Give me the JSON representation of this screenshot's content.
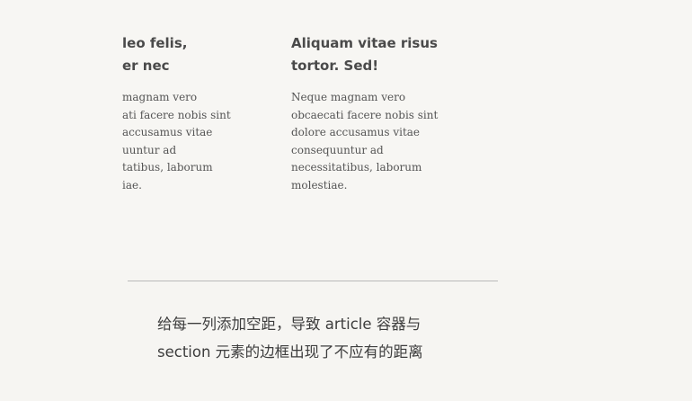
{
  "figure": {
    "left_column": {
      "title": "leo felis,\ner nec",
      "body": "magnam vero\nati facere nobis sint\naccusamus vitae\nuuntur ad\ntatibus, laborum\niae."
    },
    "right_column": {
      "title": "Aliquam vitae risus\ntortor. Sed!",
      "body": "Neque magnam vero\nobcaecati facere nobis sint\ndolore accusamus vitae\nconsequuntur ad\nnecessitatibus, laborum\nmolestiae."
    }
  },
  "caption": {
    "text": "给每一列添加空距，导致 article 容器与\nsection 元素的边框出现了不应有的距离"
  }
}
